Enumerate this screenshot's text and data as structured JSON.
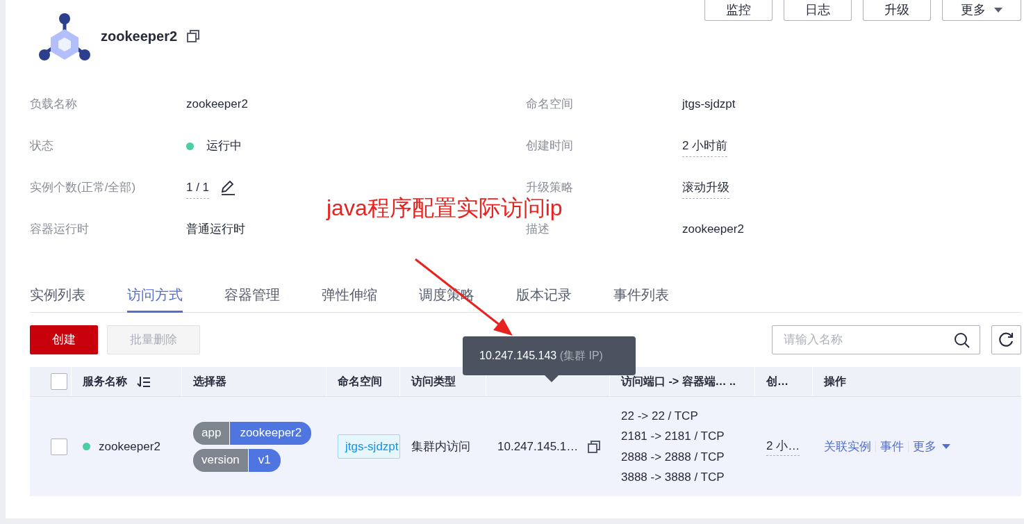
{
  "header": {
    "name": "zookeeper2",
    "buttons": [
      {
        "label": "监控",
        "kind": "plain"
      },
      {
        "label": "日志",
        "kind": "plain"
      },
      {
        "label": "升级",
        "kind": "plain"
      },
      {
        "label": "更多",
        "kind": "dropdown"
      }
    ]
  },
  "details": [
    {
      "label": "负载名称",
      "value": "zookeeper2",
      "kind": "text"
    },
    {
      "label": "命名空间",
      "value": "jtgs-sjdzpt",
      "kind": "text"
    },
    {
      "label": "状态",
      "value": "运行中",
      "kind": "status",
      "color": "#4ccfa0"
    },
    {
      "label": "创建时间",
      "value": "2 小时前",
      "kind": "hint"
    },
    {
      "label": "实例个数(正常/全部)",
      "value": "1 / 1",
      "kind": "edit"
    },
    {
      "label": "升级策略",
      "value": "滚动升级",
      "kind": "hint"
    },
    {
      "label": "容器运行时",
      "value": "普通运行时",
      "kind": "text"
    },
    {
      "label": "描述",
      "value": "zookeeper2",
      "kind": "text"
    }
  ],
  "annotation": "java程序配置实际访问ip",
  "tabs": [
    {
      "label": "实例列表",
      "selected": false
    },
    {
      "label": "访问方式",
      "selected": true
    },
    {
      "label": "容器管理",
      "selected": false
    },
    {
      "label": "弹性伸缩",
      "selected": false
    },
    {
      "label": "调度策略",
      "selected": false
    },
    {
      "label": "版本记录",
      "selected": false
    },
    {
      "label": "事件列表",
      "selected": false
    }
  ],
  "toolbar": {
    "create": {
      "label": "创建",
      "disabled": false
    },
    "batch_delete": {
      "label": "批量删除",
      "disabled": true
    },
    "search": {
      "placeholder": "请输入名称"
    }
  },
  "table": {
    "columns": [
      "服务名称",
      "选择器",
      "命名空间",
      "访问类型",
      "",
      "访问端口 -> 容器端… ..",
      "创…",
      "操作"
    ],
    "select_all_checked": false,
    "rows": [
      {
        "checked": false,
        "name": "zookeeper2",
        "color": "#4ccfa0",
        "selectors": [
          {
            "key": "app",
            "value": "zookeeper2"
          },
          {
            "key": "version",
            "value": "v1"
          }
        ],
        "namespace": "jtgs-sjdzpt",
        "access_type": "集群内访问",
        "ip": "10.247.145.1…",
        "ports": [
          "22 -> 22 / TCP",
          "2181 -> 2181 / TCP",
          "2888 -> 2888 / TCP",
          "3888 -> 3888 / TCP"
        ],
        "created": "2 小…",
        "actions": [
          {
            "label": "关联实例",
            "kind": "link"
          },
          {
            "label": "事件",
            "kind": "link"
          },
          {
            "label": "更多",
            "kind": "dropdown"
          }
        ]
      }
    ]
  },
  "tooltip": {
    "ip": "10.247.145.143",
    "note": "(集群 IP)"
  }
}
